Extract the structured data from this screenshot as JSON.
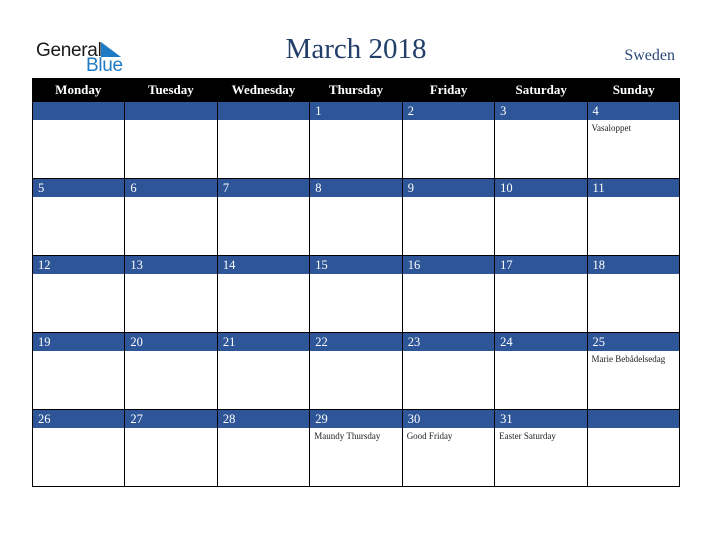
{
  "logo": {
    "word1": "General",
    "word2": "Blue"
  },
  "title": "March 2018",
  "country": "Sweden",
  "colors": {
    "header_bg": "#000000",
    "day_bar": "#2e5597",
    "title": "#223f6a",
    "logo_blue": "#1f7ac4"
  },
  "weekdays": [
    "Monday",
    "Tuesday",
    "Wednesday",
    "Thursday",
    "Friday",
    "Saturday",
    "Sunday"
  ],
  "weeks": [
    [
      {
        "day": "",
        "event": ""
      },
      {
        "day": "",
        "event": ""
      },
      {
        "day": "",
        "event": ""
      },
      {
        "day": "1",
        "event": ""
      },
      {
        "day": "2",
        "event": ""
      },
      {
        "day": "3",
        "event": ""
      },
      {
        "day": "4",
        "event": "Vasaloppet"
      }
    ],
    [
      {
        "day": "5",
        "event": ""
      },
      {
        "day": "6",
        "event": ""
      },
      {
        "day": "7",
        "event": ""
      },
      {
        "day": "8",
        "event": ""
      },
      {
        "day": "9",
        "event": ""
      },
      {
        "day": "10",
        "event": ""
      },
      {
        "day": "11",
        "event": ""
      }
    ],
    [
      {
        "day": "12",
        "event": ""
      },
      {
        "day": "13",
        "event": ""
      },
      {
        "day": "14",
        "event": ""
      },
      {
        "day": "15",
        "event": ""
      },
      {
        "day": "16",
        "event": ""
      },
      {
        "day": "17",
        "event": ""
      },
      {
        "day": "18",
        "event": ""
      }
    ],
    [
      {
        "day": "19",
        "event": ""
      },
      {
        "day": "20",
        "event": ""
      },
      {
        "day": "21",
        "event": ""
      },
      {
        "day": "22",
        "event": ""
      },
      {
        "day": "23",
        "event": ""
      },
      {
        "day": "24",
        "event": ""
      },
      {
        "day": "25",
        "event": "Marie Bebådelsedag"
      }
    ],
    [
      {
        "day": "26",
        "event": ""
      },
      {
        "day": "27",
        "event": ""
      },
      {
        "day": "28",
        "event": ""
      },
      {
        "day": "29",
        "event": "Maundy Thursday"
      },
      {
        "day": "30",
        "event": "Good Friday"
      },
      {
        "day": "31",
        "event": "Easter Saturday"
      },
      {
        "day": "",
        "event": ""
      }
    ]
  ]
}
